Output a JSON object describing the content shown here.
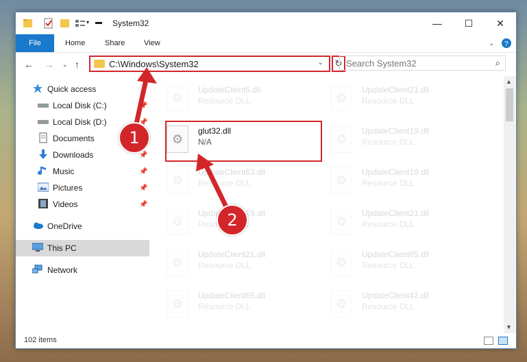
{
  "window": {
    "title": "System32"
  },
  "ribbon": {
    "file": "File",
    "tabs": [
      "Home",
      "Share",
      "View"
    ]
  },
  "address": {
    "path": "C:\\Windows\\System32"
  },
  "search": {
    "placeholder": "Search System32"
  },
  "sidebar": {
    "items": [
      {
        "label": "Quick access",
        "icon": "star-icon"
      },
      {
        "label": "Local Disk (C:)",
        "icon": "drive-icon",
        "pinned": true
      },
      {
        "label": "Local Disk (D:)",
        "icon": "drive-icon",
        "pinned": true
      },
      {
        "label": "Documents",
        "icon": "documents-icon",
        "pinned": true
      },
      {
        "label": "Downloads",
        "icon": "download-icon",
        "pinned": true
      },
      {
        "label": "Music",
        "icon": "music-icon",
        "pinned": true
      },
      {
        "label": "Pictures",
        "icon": "pictures-icon",
        "pinned": true
      },
      {
        "label": "Videos",
        "icon": "videos-icon",
        "pinned": true
      },
      {
        "label": "OneDrive",
        "icon": "cloud-icon"
      },
      {
        "label": "This PC",
        "icon": "computer-icon",
        "selected": true
      },
      {
        "label": "Network",
        "icon": "network-icon"
      }
    ]
  },
  "files": {
    "left": [
      {
        "name": "UpdateClient5.dll",
        "type": "Resource DLL"
      },
      {
        "name": "glut32.dll",
        "type": "N/A"
      },
      {
        "name": "UpdateClient63.dll",
        "type": "Resource DLL"
      },
      {
        "name": "UpdateClient19.dll",
        "type": "Resource DLL"
      },
      {
        "name": "UpdateClient21.dll",
        "type": "Resource DLL"
      },
      {
        "name": "UpdateClient65.dll",
        "type": "Resource DLL"
      }
    ],
    "right": [
      {
        "name": "UpdateClient21.dll",
        "type": "Resource DLL"
      },
      {
        "name": "UpdateClient19.dll",
        "type": "Resource DLL"
      },
      {
        "name": "UpdateClient19.dll",
        "type": "Resource DLL"
      },
      {
        "name": "UpdateClient21.dll",
        "type": "Resource DLL"
      },
      {
        "name": "UpdateClient65.dll",
        "type": "Resource DLL"
      },
      {
        "name": "UpdateClient42.dll",
        "type": "Resource DLL"
      }
    ]
  },
  "status": {
    "count": "102 items"
  },
  "callouts": [
    "1",
    "2"
  ],
  "colors": {
    "accent": "#1979ca",
    "highlight": "#d3262b"
  }
}
